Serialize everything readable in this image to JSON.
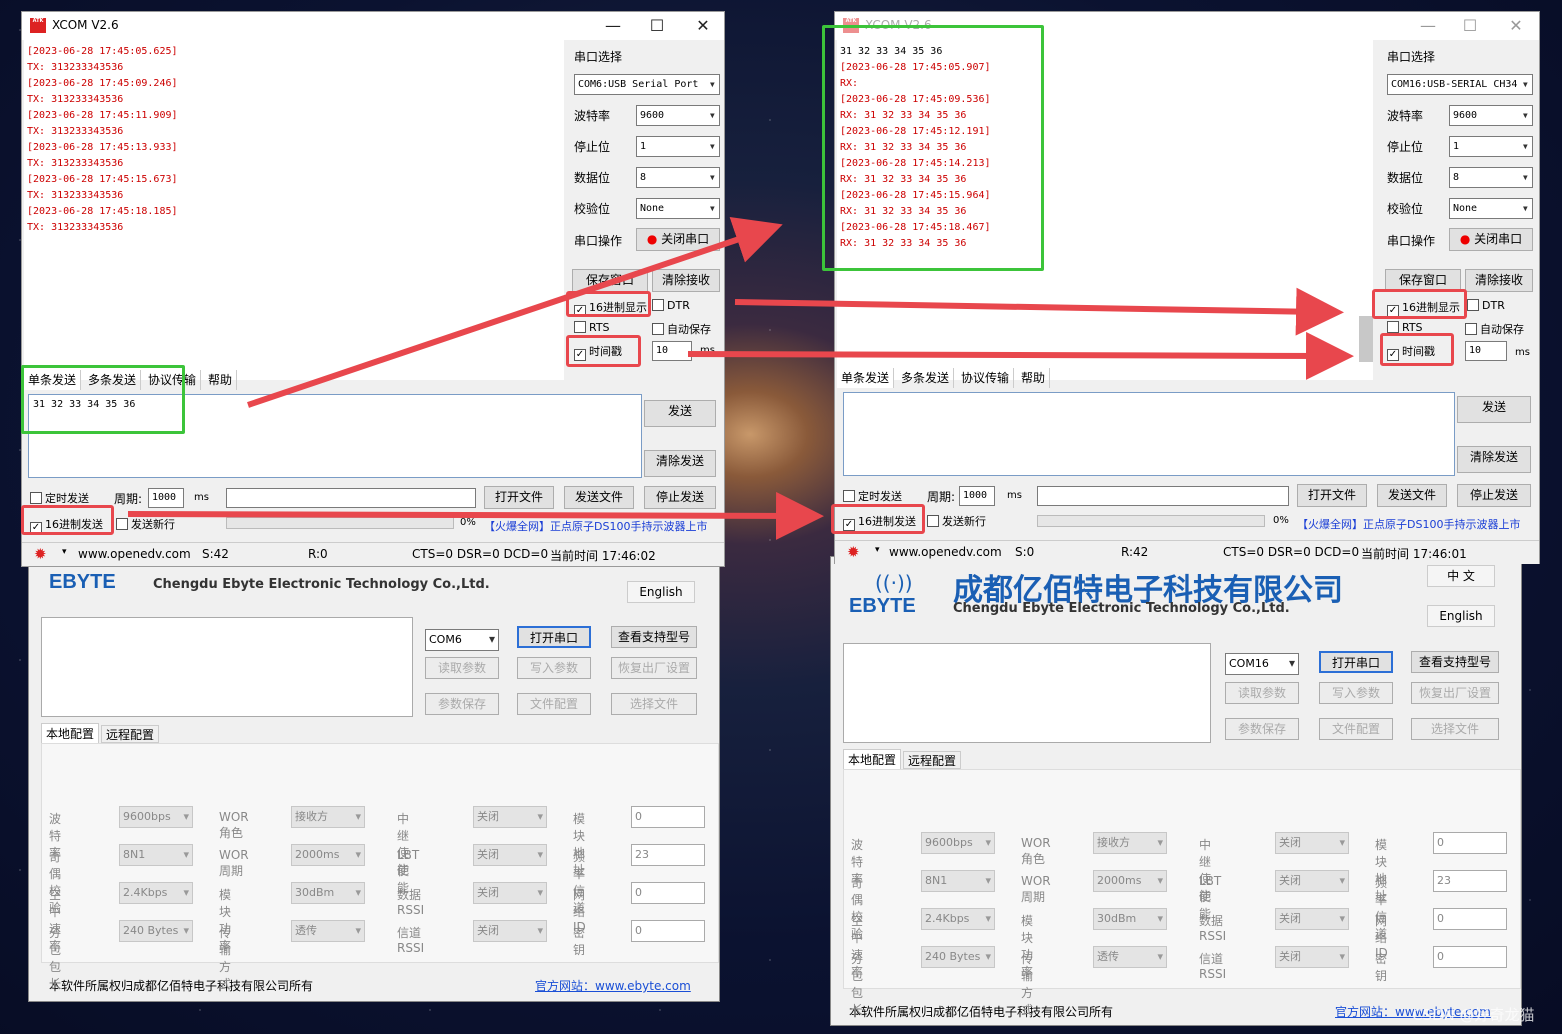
{
  "left_xcom": {
    "title": "XCOM V2.6",
    "logo_text": "ATK",
    "recv_lines": [
      {
        "kind": "ts",
        "text": "[2023-06-28 17:45:05.625]"
      },
      {
        "kind": "dat",
        "text": "TX: 313233343536"
      },
      {
        "kind": "ts",
        "text": "[2023-06-28 17:45:09.246]"
      },
      {
        "kind": "dat",
        "text": "TX: 313233343536"
      },
      {
        "kind": "ts",
        "text": "[2023-06-28 17:45:11.909]"
      },
      {
        "kind": "dat",
        "text": "TX: 313233343536"
      },
      {
        "kind": "ts",
        "text": "[2023-06-28 17:45:13.933]"
      },
      {
        "kind": "dat",
        "text": "TX: 313233343536"
      },
      {
        "kind": "ts",
        "text": "[2023-06-28 17:45:15.673]"
      },
      {
        "kind": "dat",
        "text": "TX: 313233343536"
      },
      {
        "kind": "ts",
        "text": "[2023-06-28 17:45:18.185]"
      },
      {
        "kind": "dat",
        "text": "TX: 313233343536"
      }
    ],
    "port_label": "串口选择",
    "port_value": "COM6:USB Serial Port",
    "baud_label": "波特率",
    "baud_value": "9600",
    "stop_label": "停止位",
    "stop_value": "1",
    "data_label": "数据位",
    "data_value": "8",
    "parity_label": "校验位",
    "parity_value": "None",
    "op_label": "串口操作",
    "op_button": "关闭串口",
    "save_window": "保存窗口",
    "clear_recv": "清除接收",
    "hex_display": "16进制显示",
    "dtr": "DTR",
    "rts": "RTS",
    "auto_save": "自动保存",
    "timestamp": "时间戳",
    "ts_value": "10",
    "ms": "ms",
    "tabs": [
      "单条发送",
      "多条发送",
      "协议传输",
      "帮助"
    ],
    "send_text": "31 32 33 34 35 36",
    "send_btn": "发送",
    "clear_send": "清除发送",
    "timed_send": "定时发送",
    "period_label": "周期:",
    "period_value": "1000",
    "open_file": "打开文件",
    "send_file": "发送文件",
    "stop_send": "停止发送",
    "hex_send": "16进制发送",
    "send_newline": "发送新行",
    "progress": "0%",
    "ad": "【火爆全网】正点原子DS100手持示波器上市",
    "status": {
      "url": "www.openedv.com",
      "s": "S:42",
      "r": "R:0",
      "lines": "CTS=0 DSR=0 DCD=0",
      "time": "当前时间 17:46:02"
    }
  },
  "right_xcom": {
    "title": "XCOM V2.6",
    "logo_text": "ATK",
    "recv_lines": [
      {
        "kind": "blk",
        "text": "31 32 33 34 35 36"
      },
      {
        "kind": "ts",
        "text": "[2023-06-28 17:45:05.907]"
      },
      {
        "kind": "dat",
        "text": "RX:"
      },
      {
        "kind": "ts",
        "text": "[2023-06-28 17:45:09.536]"
      },
      {
        "kind": "dat",
        "text": "RX: 31 32 33 34 35 36"
      },
      {
        "kind": "ts",
        "text": "[2023-06-28 17:45:12.191]"
      },
      {
        "kind": "dat",
        "text": "RX: 31 32 33 34 35 36"
      },
      {
        "kind": "ts",
        "text": "[2023-06-28 17:45:14.213]"
      },
      {
        "kind": "dat",
        "text": "RX: 31 32 33 34 35 36"
      },
      {
        "kind": "ts",
        "text": "[2023-06-28 17:45:15.964]"
      },
      {
        "kind": "dat",
        "text": "RX: 31 32 33 34 35 36"
      },
      {
        "kind": "ts",
        "text": "[2023-06-28 17:45:18.467]"
      },
      {
        "kind": "dat",
        "text": "RX: 31 32 33 34 35 36"
      }
    ],
    "port_label": "串口选择",
    "port_value": "COM16:USB-SERIAL CH34",
    "baud_label": "波特率",
    "baud_value": "9600",
    "stop_label": "停止位",
    "stop_value": "1",
    "data_label": "数据位",
    "data_value": "8",
    "parity_label": "校验位",
    "parity_value": "None",
    "op_label": "串口操作",
    "op_button": "关闭串口",
    "save_window": "保存窗口",
    "clear_recv": "清除接收",
    "hex_display": "16进制显示",
    "dtr": "DTR",
    "rts": "RTS",
    "auto_save": "自动保存",
    "timestamp": "时间戳",
    "ts_value": "10",
    "ms": "ms",
    "tabs": [
      "单条发送",
      "多条发送",
      "协议传输",
      "帮助"
    ],
    "send_text": "",
    "send_btn": "发送",
    "clear_send": "清除发送",
    "timed_send": "定时发送",
    "period_label": "周期:",
    "period_value": "1000",
    "open_file": "打开文件",
    "send_file": "发送文件",
    "stop_send": "停止发送",
    "hex_send": "16进制发送",
    "send_newline": "发送新行",
    "progress": "0%",
    "ad": "【火爆全网】正点原子DS100手持示波器上市",
    "status": {
      "url": "www.openedv.com",
      "s": "S:0",
      "r": "R:42",
      "lines": "CTS=0 DSR=0 DCD=0",
      "time": "当前时间 17:46:01"
    }
  },
  "ebyte": {
    "company_cn": "成都亿佰特电子科技有限公司",
    "company_en": "Chengdu Ebyte Electronic Technology Co.,Ltd.",
    "logo": "EBYTE",
    "lang_cn": "中 文",
    "lang_en": "English",
    "left_com": "COM6",
    "right_com": "COM16",
    "open_port": "打开串口",
    "supported": "查看支持型号",
    "read_params": "读取参数",
    "write_params": "写入参数",
    "factory": "恢复出厂设置",
    "save_params": "参数保存",
    "file_config": "文件配置",
    "select_file": "选择文件",
    "tab_local": "本地配置",
    "tab_remote": "远程配置",
    "rows": [
      {
        "l1": "波 特 率",
        "v1": "9600bps",
        "l2": "WOR角色",
        "v2": "接收方",
        "l3": "中继使能",
        "v3": "关闭",
        "l4": "模块地址",
        "v4": "0"
      },
      {
        "l1": "奇偶校验",
        "v1": "8N1",
        "l2": "WOR周期",
        "v2": "2000ms",
        "l3": "LBT 使能",
        "v3": "关闭",
        "l4": "频率信道",
        "v4": "23"
      },
      {
        "l1": "空中速率",
        "v1": "2.4Kbps",
        "l2": "模块功率",
        "v2": "30dBm",
        "l3": "数据RSSI",
        "v3": "关闭",
        "l4": "网络  ID",
        "v4": "0"
      },
      {
        "l1": "分包包长",
        "v1": "240 Bytes",
        "l2": "传输方式",
        "v2": "透传",
        "l3": "信道RSSI",
        "v3": "关闭",
        "l4": "密    钥",
        "v4": "0"
      }
    ],
    "copyright": "本软件所属权归成都亿佰特电子科技有限公司所有",
    "website": "官方网站：www.ebyte.com"
  },
  "watermark": "CSDN @好奇龙猫"
}
